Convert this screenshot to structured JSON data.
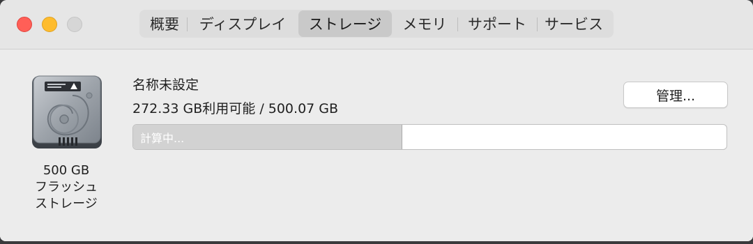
{
  "tabs": [
    {
      "label": "概要",
      "active": false
    },
    {
      "label": "ディスプレイ",
      "active": false
    },
    {
      "label": "ストレージ",
      "active": true
    },
    {
      "label": "メモリ",
      "active": false
    },
    {
      "label": "サポート",
      "active": false
    },
    {
      "label": "サービス",
      "active": false
    }
  ],
  "drive": {
    "icon": "hard-drive-icon",
    "caption_line1": "500 GB",
    "caption_line2": "フラッシュ",
    "caption_line3": "ストレージ"
  },
  "volume": {
    "name": "名称未設定",
    "availability": "272.33 GB利用可能 / 500.07 GB",
    "manage_label": "管理...",
    "status_label": "計算中...",
    "used_fraction": 0.454
  },
  "colors": {
    "close": "#ff5f57",
    "minimize": "#febc2e",
    "maximize": "#d6d6d6"
  }
}
